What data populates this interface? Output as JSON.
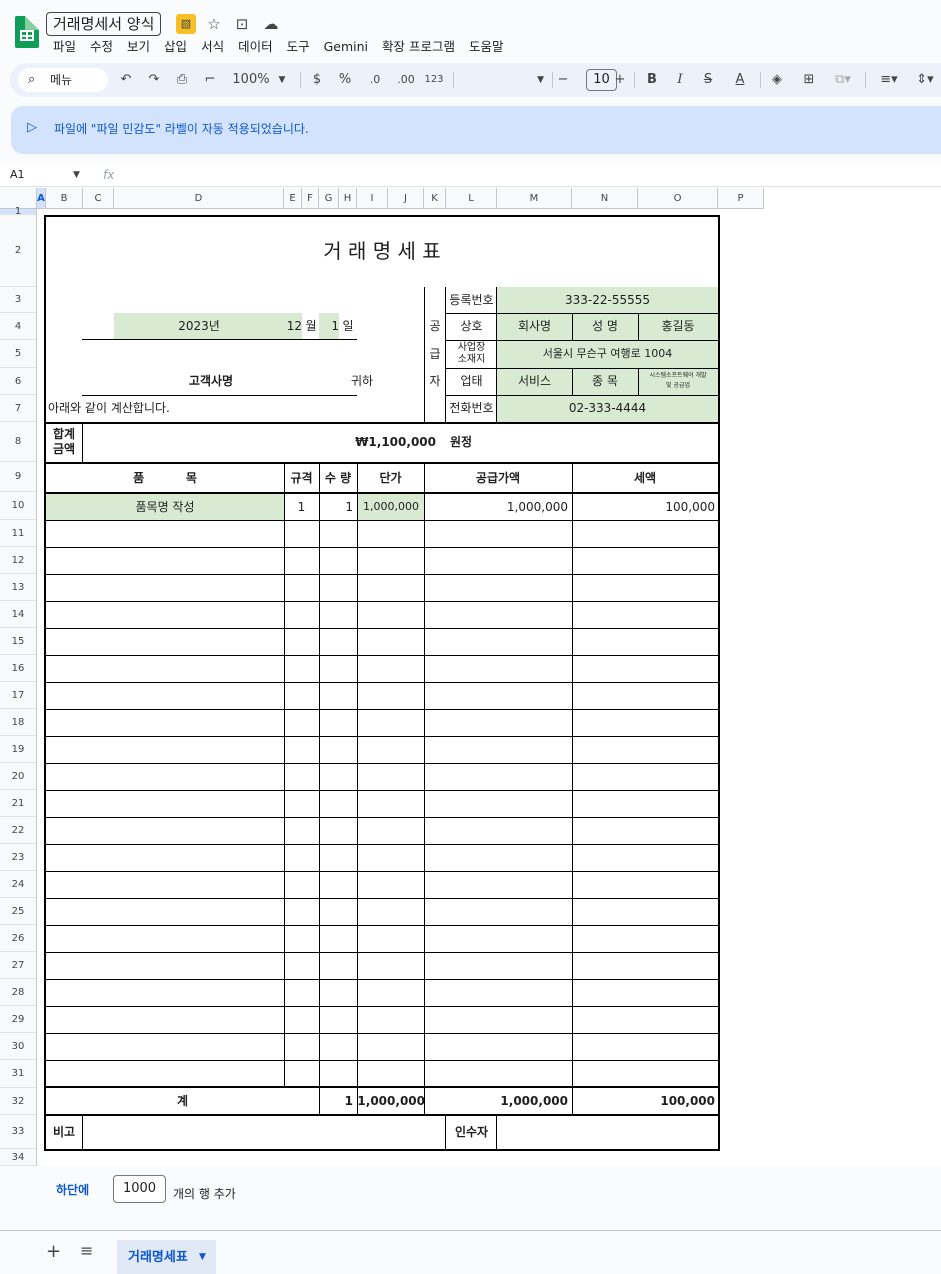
{
  "header": {
    "doc_title": "거래명세서 양식",
    "menu": [
      "파일",
      "수정",
      "보기",
      "삽입",
      "서식",
      "데이터",
      "도구",
      "Gemini",
      "확장 프로그램",
      "도움말"
    ]
  },
  "toolbar": {
    "search_label": "메뉴",
    "zoom": "100%",
    "currency": "$",
    "percent": "%",
    "dec_decrease": ".0",
    "dec_increase": ".00",
    "number_format": "123",
    "font_size": "10",
    "minus": "−",
    "plus": "+",
    "bold": "B",
    "italic": "I",
    "strike": "S",
    "text_color": "A"
  },
  "banner": {
    "text": "파일에 \"파일 민감도\" 라벨이 자동 적용되었습니다."
  },
  "formula_bar": {
    "cell_ref": "A1",
    "fx": "fx"
  },
  "columns": [
    "A",
    "B",
    "C",
    "D",
    "E",
    "F",
    "G",
    "H",
    "I",
    "J",
    "K",
    "L",
    "M",
    "N",
    "O",
    "P"
  ],
  "rows": [
    "1",
    "2",
    "3",
    "4",
    "5",
    "6",
    "7",
    "8",
    "9",
    "10",
    "11",
    "12",
    "13",
    "14",
    "15",
    "16",
    "17",
    "18",
    "19",
    "20",
    "21",
    "22",
    "23",
    "24",
    "25",
    "26",
    "27",
    "28",
    "29",
    "30",
    "31",
    "32",
    "33",
    "34"
  ],
  "form": {
    "title": "거 래 명 세 표",
    "year": "2023년",
    "month": "12",
    "month_unit": "월",
    "day": "1",
    "day_unit": "일",
    "customer": "고객사명",
    "honorific": "귀하",
    "statement": "아래와 같이 계산합니다.",
    "supplier_label": [
      "공",
      "급",
      "자"
    ],
    "reg_no_label": "등록번호",
    "reg_no": "333-22-55555",
    "company_label": "상호",
    "company": "회사명",
    "name_label": "성  명",
    "name": "홍길동",
    "address_label_1": "사업장",
    "address_label_2": "소재지",
    "address": "서울시 무슨구 여행로 1004",
    "biz_type_label": "업태",
    "biz_type": "서비스",
    "biz_item_label": "종  목",
    "biz_item_1": "시스템소프트웨어 개발",
    "biz_item_2": "및 공급업",
    "phone_label": "전화번호",
    "phone": "02-333-4444",
    "total_label_1": "합계",
    "total_label_2": "금액",
    "total_amount": "₩1,100,000",
    "total_unit": "원정",
    "col_item": "품          목",
    "col_spec": "규격",
    "col_qty": "수 량",
    "col_price": "단가",
    "col_supply": "공급가액",
    "col_tax": "세액",
    "item_name": "품목명 작성",
    "item_spec": "1",
    "item_qty": "1",
    "item_price": "1,000,000",
    "item_supply": "1,000,000",
    "item_tax": "100,000",
    "sum_label": "계",
    "sum_qty": "1",
    "sum_price": "1,000,000",
    "sum_supply": "1,000,000",
    "sum_tax": "100,000",
    "remarks_label": "비고",
    "receiver_label": "인수자"
  },
  "bottom": {
    "at_bottom": "하단에",
    "row_count": "1000",
    "add_rows": "개의 행 추가"
  },
  "sheet_tab": {
    "name": "거래명세표"
  }
}
